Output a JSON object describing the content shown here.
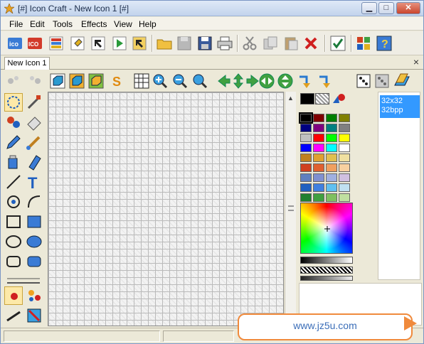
{
  "window": {
    "title": "[#] Icon Craft - New Icon 1 [#]",
    "min_label": "▁",
    "max_label": "□",
    "close_label": "✕"
  },
  "menu": {
    "items": [
      "File",
      "Edit",
      "Tools",
      "Effects",
      "View",
      "Help"
    ]
  },
  "toolbar1": {
    "ico_label": "ico",
    "ico2_label": "ICO",
    "icons": [
      "new-ico-icon",
      "new-ico2-icon",
      "layers-icon",
      "select-icon",
      "arrow-icon",
      "play-icon",
      "frame-icon",
      "open-folder-icon",
      "save-disabled-icon",
      "save-icon",
      "print-icon",
      "cut-icon",
      "copy-icon",
      "paste-icon",
      "delete-icon",
      "checkmark-icon",
      "windows-icon",
      "help-icon"
    ]
  },
  "tabs": {
    "active_label": "New Icon 1",
    "close_label": "×"
  },
  "toolbar2": {
    "s_label": "S",
    "icons": [
      "undo-icon",
      "redo-icon",
      "cube-blue-icon",
      "cube-orange-icon",
      "cube-green-icon",
      "s-icon",
      "grid-icon",
      "zoom-in-icon",
      "zoom-out-icon",
      "zoom-fit-icon",
      "move-left-icon",
      "move-up-down-icon",
      "move-right-icon",
      "flip-horizontal-icon",
      "flip-vertical-icon",
      "rotate-down-icon",
      "rotate-up-icon",
      "dice-icon",
      "dice-gray-icon",
      "plane-icon"
    ]
  },
  "tools": [
    "selection",
    "eyedropper",
    "color-replace",
    "eraser",
    "pencil",
    "brush",
    "fill-bucket",
    "marker",
    "line",
    "text-t",
    "ellipse-arc",
    "curve",
    "rectangle-outline",
    "rectangle-filled",
    "ellipse-outline",
    "ellipse-filled",
    "rounded-rect-outline",
    "rounded-rect-filled",
    "line-width",
    "dot-tool",
    "multi-dot",
    "line-tool-2",
    "brush-check"
  ],
  "palette": {
    "colors": [
      [
        "#000000",
        "#800000",
        "#008000",
        "#808000"
      ],
      [
        "#000080",
        "#800080",
        "#008080",
        "#808080"
      ],
      [
        "#c0c0c0",
        "#ff0000",
        "#00ff00",
        "#ffff00"
      ],
      [
        "#0000ff",
        "#ff00ff",
        "#00ffff",
        "#ffffff"
      ],
      [
        "#c08020",
        "#e0a030",
        "#e0c050",
        "#f0e0a0"
      ],
      [
        "#d04020",
        "#e06030",
        "#f0a060",
        "#f8d0a0"
      ],
      [
        "#6080c0",
        "#8090d0",
        "#a0b0e0",
        "#d0c0e0"
      ],
      [
        "#2060c0",
        "#4080e0",
        "#60c0f0",
        "#c0e0f0"
      ],
      [
        "#208030",
        "#40a040",
        "#80c060",
        "#c0e0a0"
      ]
    ]
  },
  "format": {
    "label": "32x32\n32bpp",
    "line1": "32x32",
    "line2": "32bpp"
  },
  "watermark": {
    "text": "www.jz5u.com"
  },
  "colors": {
    "accent": "#3399ff",
    "callout_border": "#f08a3c",
    "callout_text": "#3b6eb8"
  }
}
